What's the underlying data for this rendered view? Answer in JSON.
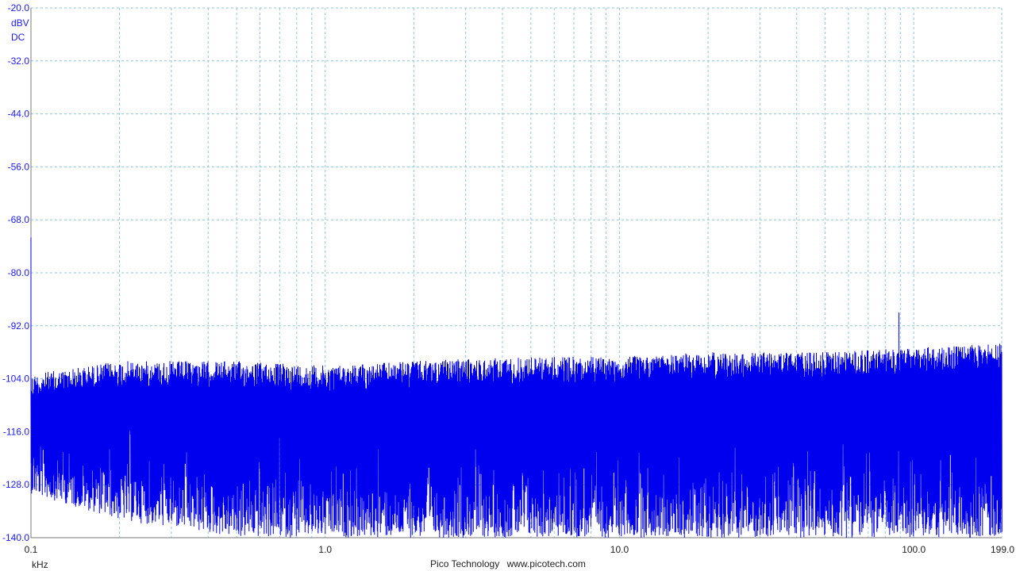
{
  "chart_data": {
    "type": "line",
    "x_scale": "log",
    "x_unit": "kHz",
    "y_unit": "dBV",
    "y_coupling": "DC",
    "xlim": [
      0.1,
      199.0
    ],
    "ylim": [
      -140.0,
      -20.0
    ],
    "y_ticks": [
      "-20.0",
      "-32.0",
      "-44.0",
      "-56.0",
      "-68.0",
      "-80.0",
      "-92.0",
      "-104.0",
      "-116.0",
      "-128.0",
      "-140.0"
    ],
    "x_ticks": [
      {
        "value": 0.1,
        "label": "0.1"
      },
      {
        "value": 1.0,
        "label": "1.0"
      },
      {
        "value": 10.0,
        "label": "10.0"
      },
      {
        "value": 100.0,
        "label": "100.0"
      },
      {
        "value": 199.0,
        "label": "199.0"
      }
    ],
    "grid": true,
    "line_color": "#0000ee",
    "grid_color": "#8fc7d9",
    "series": [
      {
        "values_desc": "",
        "noise_envelope": {
          "x": [
            0.1,
            0.2,
            0.5,
            1.0,
            2.0,
            5.0,
            10.0,
            20.0,
            50.0,
            100.0,
            199.0
          ],
          "peak_top": [
            -103,
            -100,
            -100,
            -101,
            -100,
            -99,
            -99,
            -98,
            -98,
            -97,
            -96
          ],
          "floor_bottom": [
            -130,
            -136,
            -140,
            -140,
            -140,
            -140,
            -140,
            -140,
            -140,
            -140,
            -140
          ]
        },
        "spikes": [
          {
            "x": 0.1,
            "y": -72.0
          },
          {
            "x": 89.0,
            "y": -89.0
          }
        ]
      }
    ]
  },
  "footer": {
    "brand": "Pico Technology",
    "url": "www.picotech.com"
  }
}
